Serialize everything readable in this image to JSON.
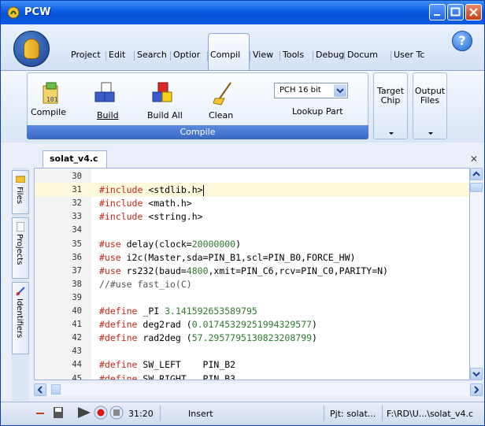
{
  "window": {
    "title": "PCW"
  },
  "menu": {
    "tabs": [
      "Project",
      "Edit",
      "Search",
      "Optior",
      "Compil",
      "View",
      "Tools",
      "Debug",
      "Docum",
      "User Tc"
    ],
    "active_tab": "Compil"
  },
  "ribbon": {
    "buttons": {
      "compile": "Compile",
      "build": "Build",
      "build_all": "Build All",
      "clean": "Clean"
    },
    "compiler_select": "PCH 16 bit",
    "lookup_part": "Lookup Part",
    "group_caption": "Compile",
    "target_chip": "Target\nChip",
    "output_files": "Output\nFiles"
  },
  "editor": {
    "file_tab": "solat_v4.c",
    "side_tabs": [
      "Files",
      "Projects",
      "Identifiers"
    ],
    "lines": [
      {
        "n": "30",
        "parts": []
      },
      {
        "n": "31",
        "parts": [
          {
            "c": "pp",
            "t": "#include"
          },
          {
            "c": "",
            "t": " <stdlib.h>"
          }
        ],
        "current": true
      },
      {
        "n": "32",
        "parts": [
          {
            "c": "pp",
            "t": "#include"
          },
          {
            "c": "",
            "t": " <math.h>"
          }
        ]
      },
      {
        "n": "33",
        "parts": [
          {
            "c": "pp",
            "t": "#include"
          },
          {
            "c": "",
            "t": " <string.h>"
          }
        ]
      },
      {
        "n": "34",
        "parts": []
      },
      {
        "n": "35",
        "parts": [
          {
            "c": "pp",
            "t": "#use"
          },
          {
            "c": "",
            "t": " delay(clock="
          },
          {
            "c": "num",
            "t": "20000000"
          },
          {
            "c": "",
            "t": ")"
          }
        ]
      },
      {
        "n": "36",
        "parts": [
          {
            "c": "pp",
            "t": "#use"
          },
          {
            "c": "",
            "t": " i2c(Master,sda=PIN_B1,scl=PIN_B0,FORCE_HW)"
          }
        ]
      },
      {
        "n": "37",
        "parts": [
          {
            "c": "pp",
            "t": "#use"
          },
          {
            "c": "",
            "t": " rs232(baud="
          },
          {
            "c": "num",
            "t": "4800"
          },
          {
            "c": "",
            "t": ",xmit=PIN_C6,rcv=PIN_C0,PARITY=N)"
          }
        ]
      },
      {
        "n": "38",
        "parts": [
          {
            "c": "cmt",
            "t": "//#use fast_io(C)"
          }
        ]
      },
      {
        "n": "39",
        "parts": []
      },
      {
        "n": "40",
        "parts": [
          {
            "c": "pp",
            "t": "#define"
          },
          {
            "c": "",
            "t": " _PI "
          },
          {
            "c": "num",
            "t": "3.141592653589795"
          }
        ]
      },
      {
        "n": "41",
        "parts": [
          {
            "c": "pp",
            "t": "#define"
          },
          {
            "c": "",
            "t": " deg2rad ("
          },
          {
            "c": "num",
            "t": "0.01745329251994329577"
          },
          {
            "c": "",
            "t": ")"
          }
        ]
      },
      {
        "n": "42",
        "parts": [
          {
            "c": "pp",
            "t": "#define"
          },
          {
            "c": "",
            "t": " rad2deg ("
          },
          {
            "c": "num",
            "t": "57.2957795130823208799"
          },
          {
            "c": "",
            "t": ")"
          }
        ]
      },
      {
        "n": "43",
        "parts": []
      },
      {
        "n": "44",
        "parts": [
          {
            "c": "pp",
            "t": "#define"
          },
          {
            "c": "",
            "t": " SW_LEFT    PIN_B2"
          }
        ]
      },
      {
        "n": "45",
        "parts": [
          {
            "c": "pp",
            "t": "#define"
          },
          {
            "c": "",
            "t": " SW_RIGHT   PIN_B3"
          }
        ]
      }
    ]
  },
  "status": {
    "position": "31:20",
    "mode": "Insert",
    "project": "Pjt: solat...",
    "path": "F:\\RD\\U...\\solat_v4.c"
  }
}
